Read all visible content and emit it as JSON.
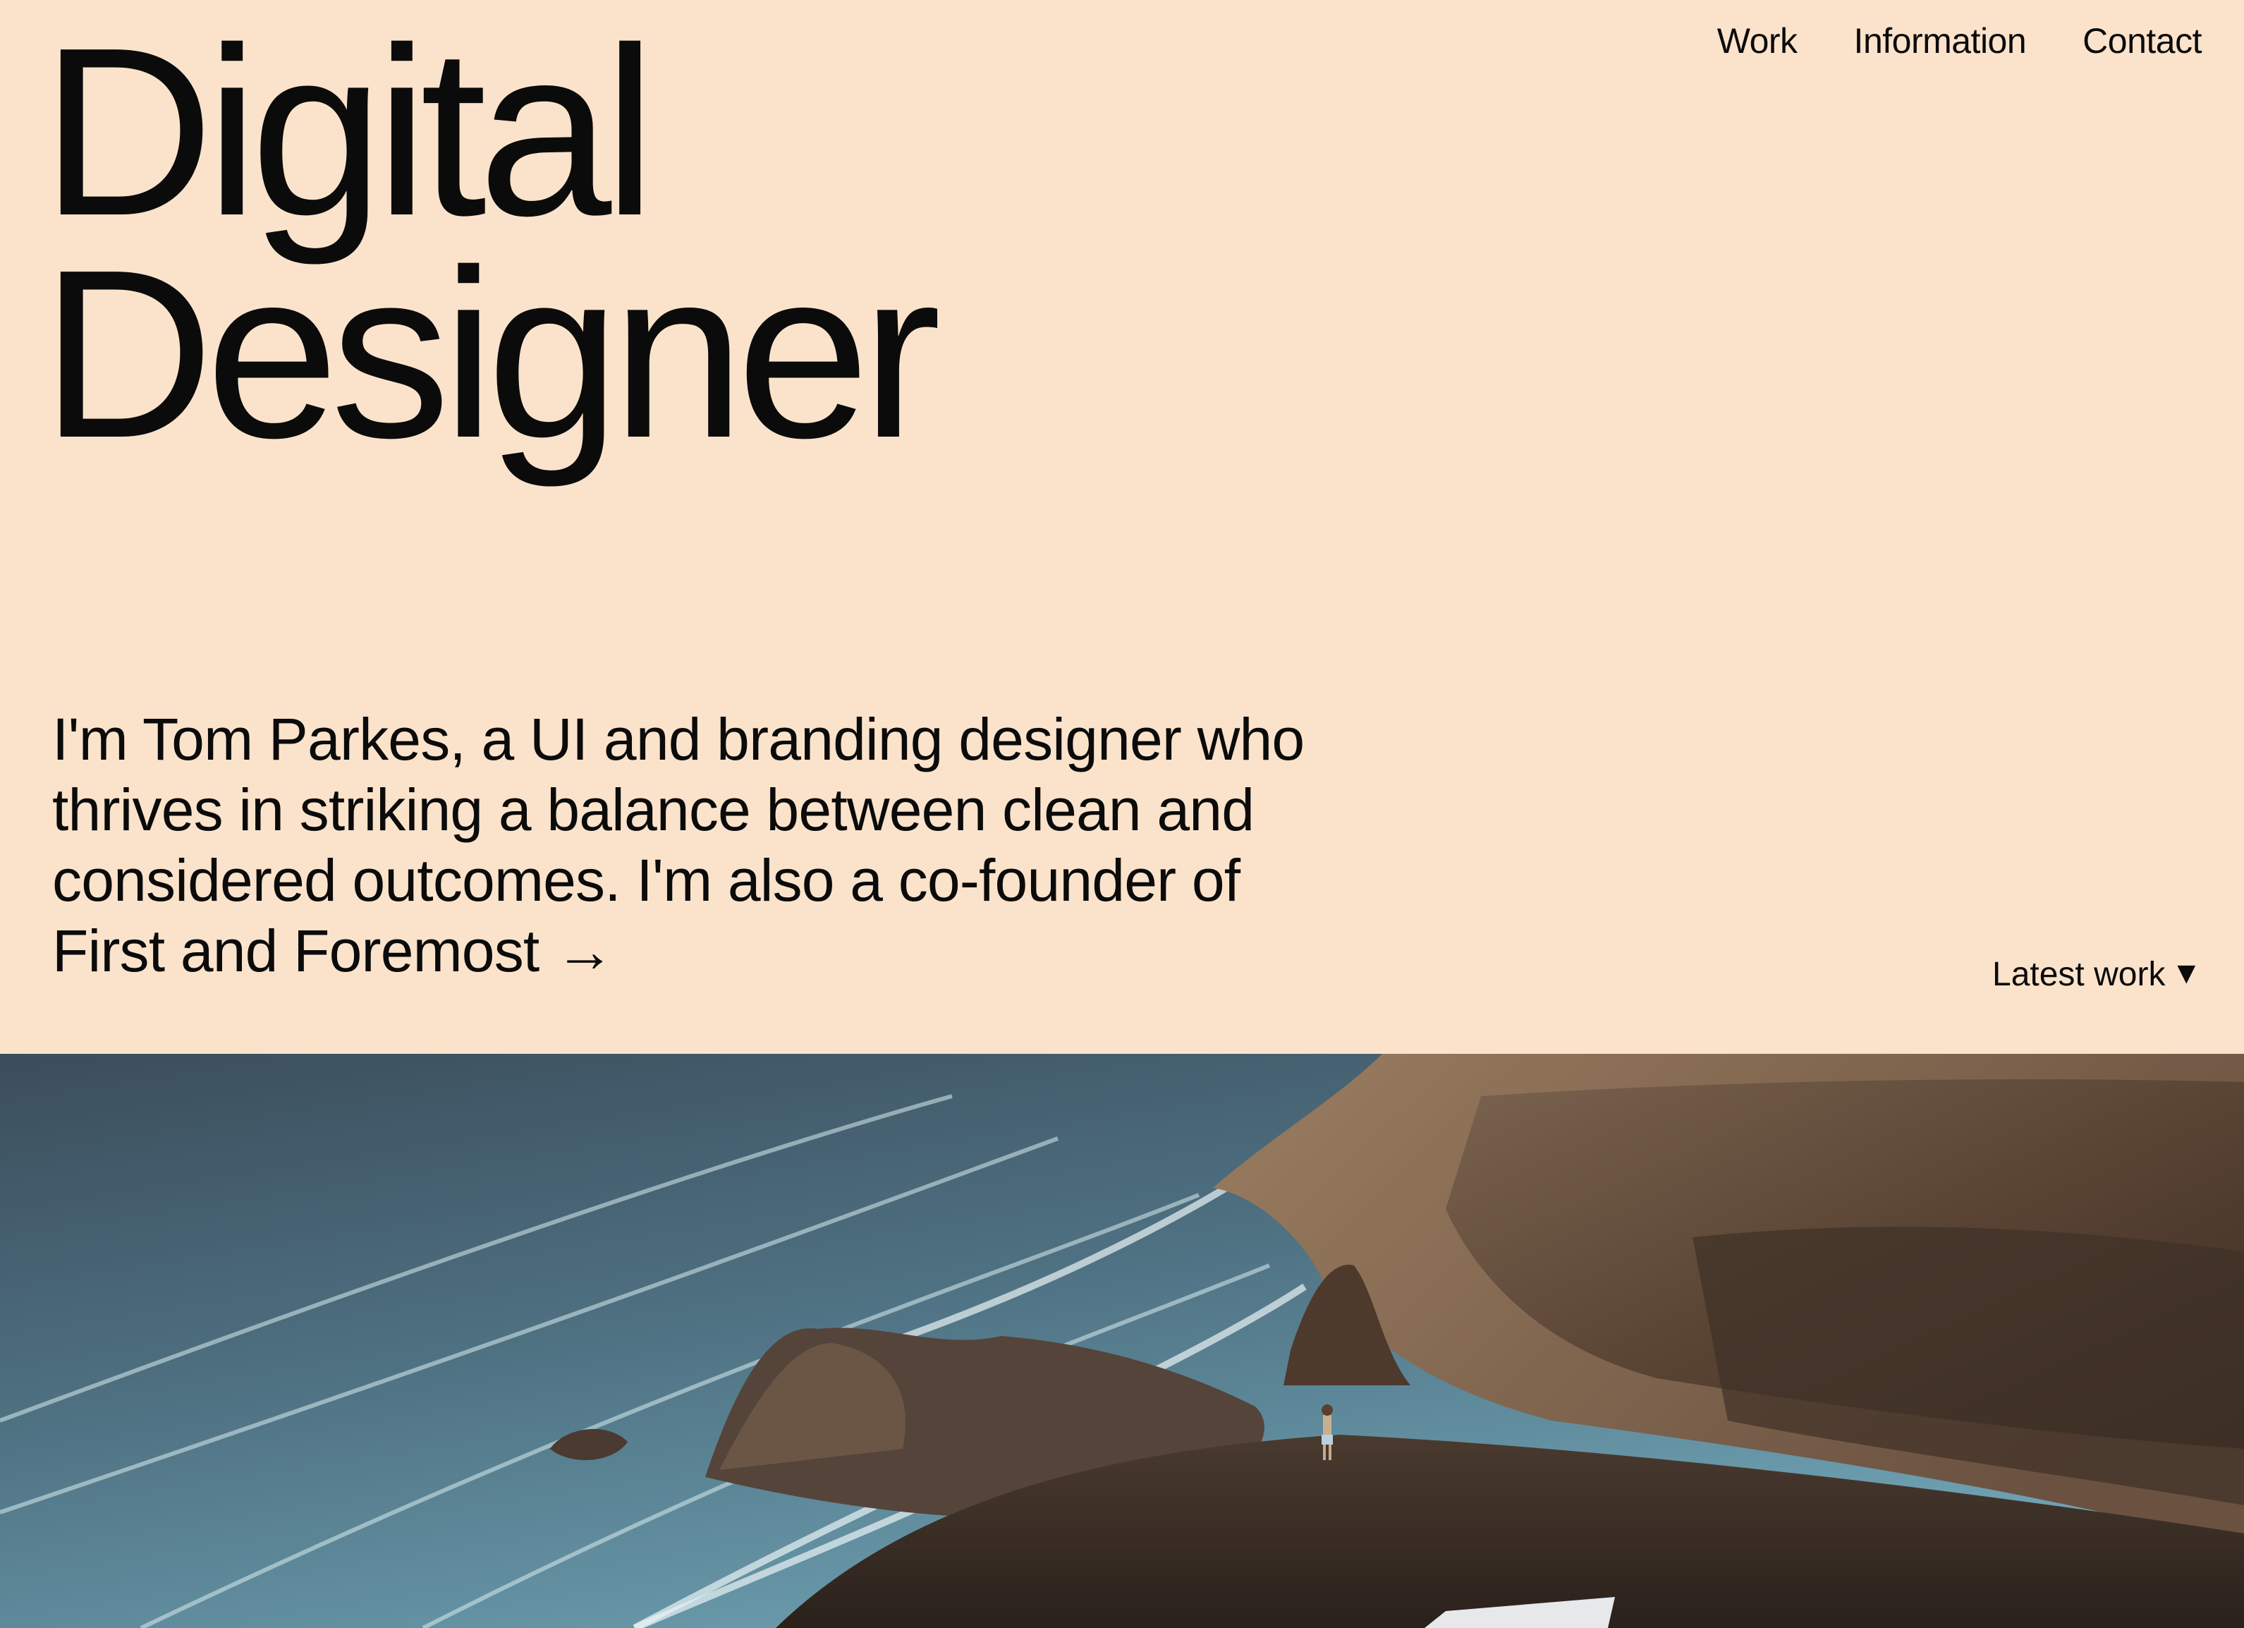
{
  "nav": {
    "items": [
      {
        "label": "Work"
      },
      {
        "label": "Information"
      },
      {
        "label": "Contact"
      }
    ]
  },
  "hero": {
    "line1": "Digital",
    "line2": "Designer"
  },
  "intro": {
    "text": "I'm Tom Parkes, a UI and branding designer who thrives in striking a balance between clean and considered outcomes. I'm also a co-founder of ",
    "link_label": "First and Foremost",
    "link_icon": "arrow-right-icon",
    "link_arrow": "→"
  },
  "latest": {
    "label": "Latest work",
    "icon": "triangle-down-icon",
    "glyph": "▼"
  },
  "photo": {
    "description_icon": "coastal-landscape-photo"
  },
  "colors": {
    "background": "#fbe3cb",
    "text": "#0b0b0b"
  }
}
